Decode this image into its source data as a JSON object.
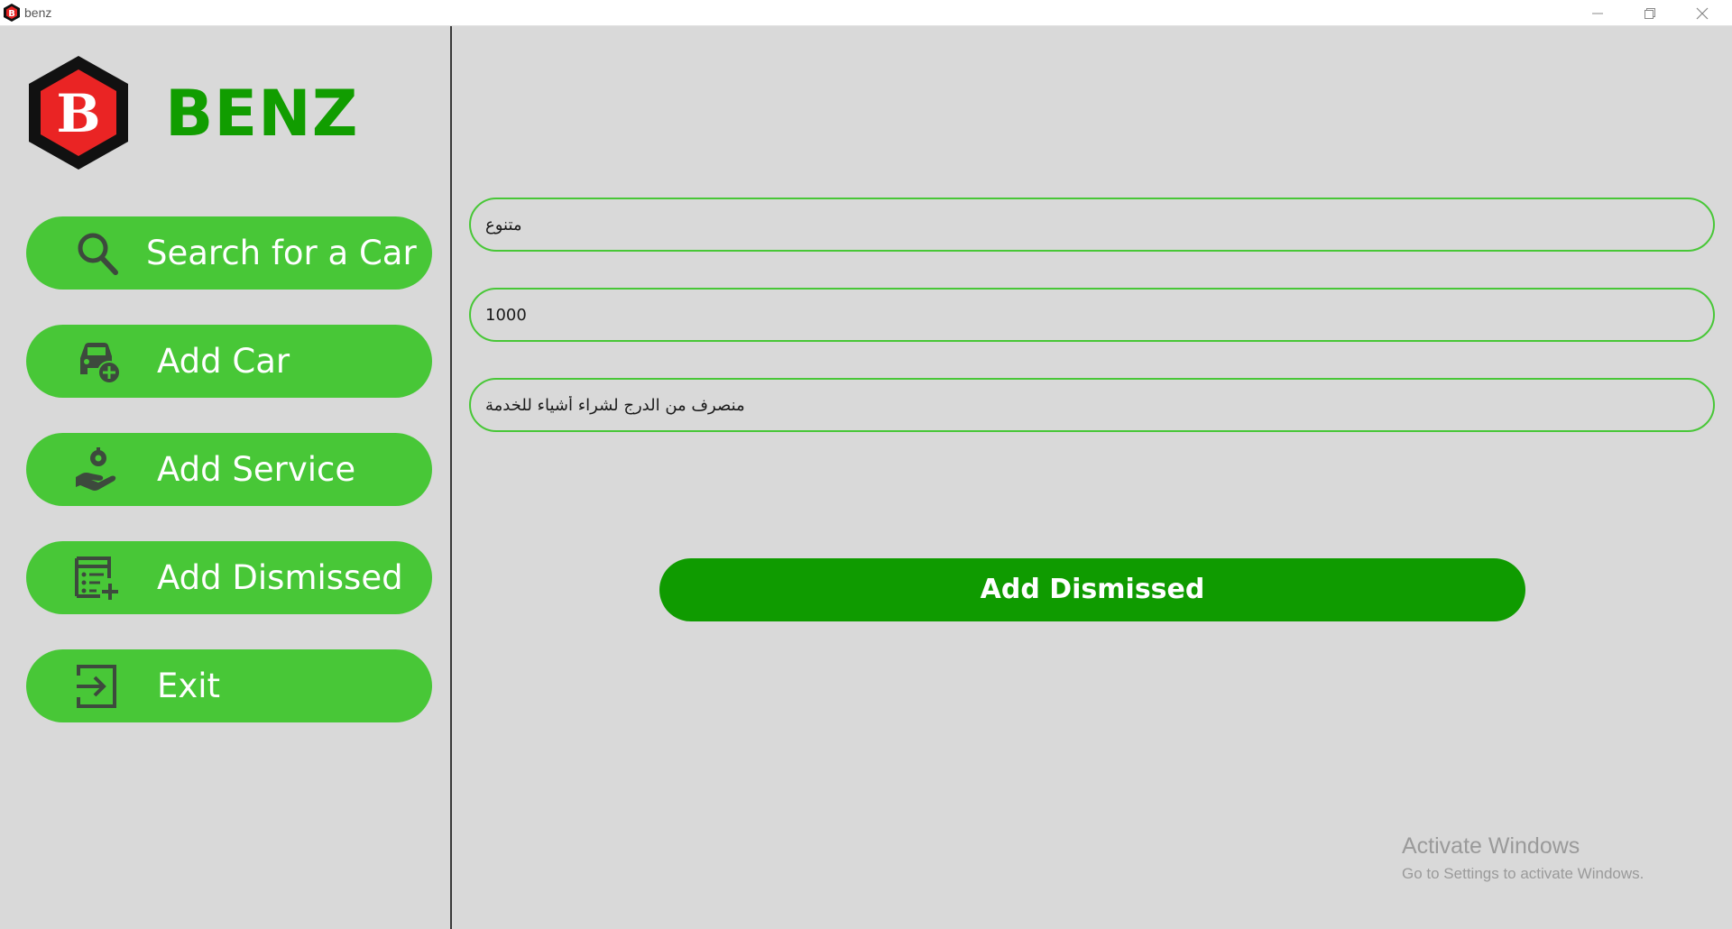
{
  "window": {
    "title": "benz",
    "controls": [
      "minimize-icon",
      "restore-icon",
      "close-icon"
    ]
  },
  "brand": {
    "logo_letter": "B",
    "name": "BENZ",
    "color": "#119d00"
  },
  "sidebar": {
    "items": [
      {
        "label": "Search for a Car",
        "icon": "search-icon"
      },
      {
        "label": "Add Car",
        "icon": "car-add-icon"
      },
      {
        "label": "Add Service",
        "icon": "service-hand-icon"
      },
      {
        "label": "Add Dismissed",
        "icon": "list-add-icon"
      },
      {
        "label": "Exit",
        "icon": "exit-icon"
      }
    ],
    "button_color": "#48c737"
  },
  "form": {
    "fields": [
      {
        "value": "متنوع"
      },
      {
        "value": "1000"
      },
      {
        "value": "منصرف من الدرج لشراء أشياء للخدمة"
      }
    ],
    "submit_label": "Add Dismissed",
    "submit_color": "#0f9b00"
  },
  "watermark": {
    "line1": "Activate Windows",
    "line2": "Go to Settings to activate Windows."
  }
}
